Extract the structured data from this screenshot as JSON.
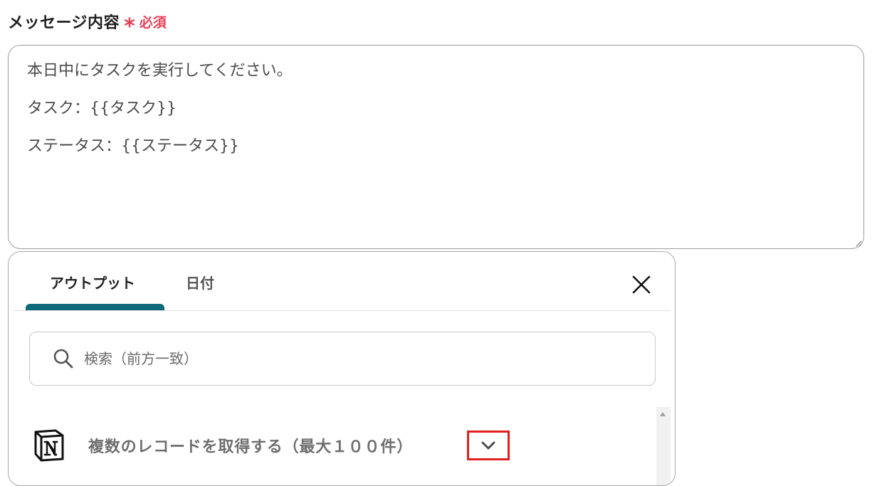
{
  "field": {
    "label": "メッセージ内容",
    "required_mark": "*",
    "required_text": "必須"
  },
  "message": {
    "lines": [
      "本日中にタスクを実行してください。",
      "タスク：{{タスク}}",
      "ステータス：{{ステータス}}"
    ]
  },
  "panel": {
    "tabs": [
      {
        "label": "アウトプット",
        "active": true
      },
      {
        "label": "日付",
        "active": false
      }
    ],
    "close_icon": "close-icon",
    "search": {
      "icon": "search-icon",
      "value": "",
      "placeholder": "検索（前方一致）"
    },
    "records": [
      {
        "icon": "notion-logo",
        "label": "複数のレコードを取得する（最大１００件）",
        "expand_icon": "chevron-down-icon"
      }
    ]
  },
  "colors": {
    "required": "#e8425a",
    "active_tab_underline": "#0e6a7a",
    "highlight_box": "#e02020"
  }
}
